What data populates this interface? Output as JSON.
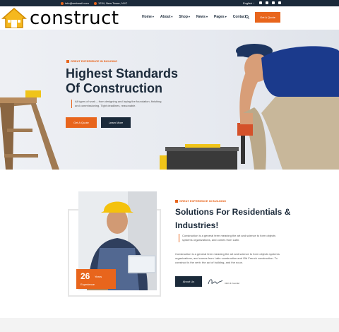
{
  "colors": {
    "accent": "#e8651c",
    "navy": "#1b2a3a"
  },
  "topbar": {
    "email": "info@webmail.com",
    "address": "1234, New Tower, NYC",
    "language": "English ↓",
    "social_icons": [
      "facebook-icon",
      "twitter-icon",
      "vimeo-icon",
      "pinterest-icon"
    ]
  },
  "header": {
    "logo_text": "construct",
    "nav": [
      "Home",
      "About",
      "Shop",
      "News",
      "Pages",
      "Contact"
    ],
    "cta": "Get A Quote"
  },
  "hero": {
    "eyebrow": "GREAT EXPERIENCE IN BUILDING",
    "title_line1": "Highest Standards",
    "title_line2": "Of Construction",
    "text": "All types of work – from designing and laying the foundation, finishing and commissioning. Tight deadlines, reasonable.",
    "btn_primary": "Get A Quote",
    "btn_secondary": "Learn More"
  },
  "about": {
    "experience_number": "26",
    "experience_unit": "Years",
    "experience_label": "Experience",
    "eyebrow": "GREAT EXPERIENCE IN BUILDING",
    "title": "Solutions For Residentials & Industries!",
    "paragraph1": "Construction is a general term meaning the art and science to form objects systems organizations, and comes from Latin.",
    "paragraph2": "Construction is a general term meaning the art and science to form objects systems organizations, and comes from Latin construction and Old French construction. To construct is the verb: the act of building, and the noun.",
    "button": "About Us",
    "signature_role": "CEO & Founder"
  }
}
